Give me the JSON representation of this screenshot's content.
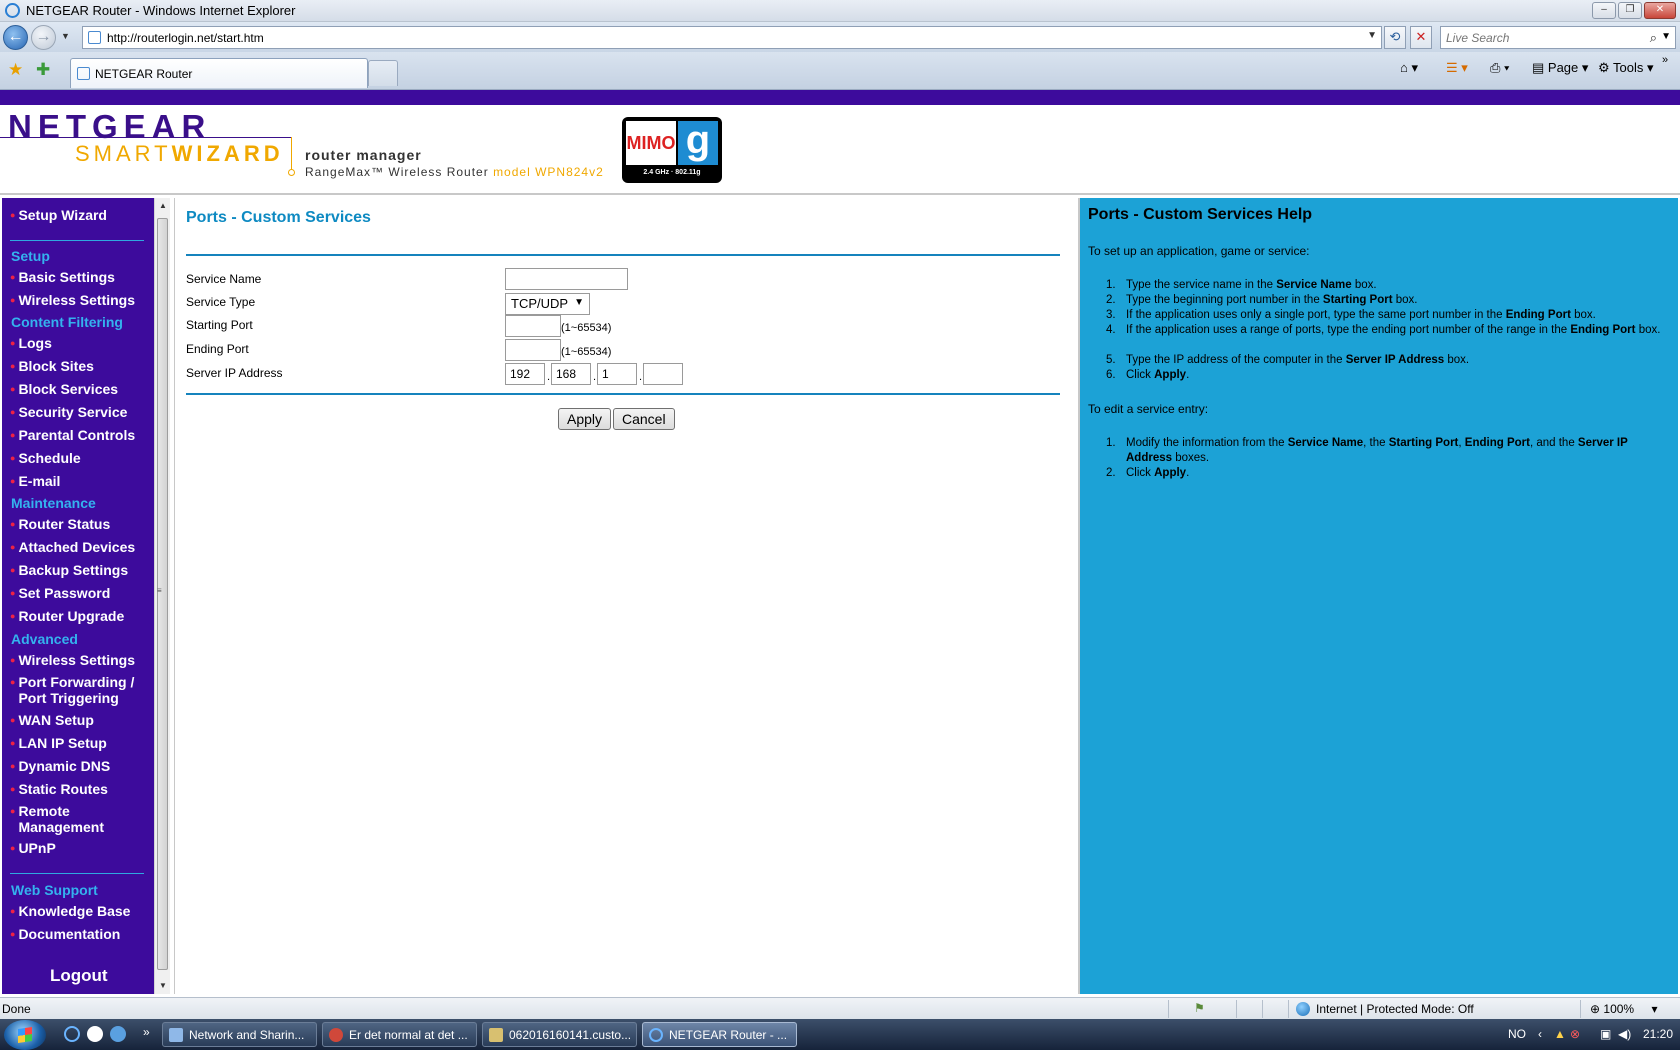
{
  "browser": {
    "window_title": "NETGEAR Router - Windows Internet Explorer",
    "url": "http://routerlogin.net/start.htm",
    "search_placeholder": "Live Search",
    "tab_label": "NETGEAR Router",
    "toolbar": {
      "page_label": "Page",
      "tools_label": "Tools"
    }
  },
  "header": {
    "brand": "NETGEAR",
    "smart": "SMART",
    "wizard": "WIZARD",
    "router_manager": "router manager",
    "product": "RangeMax™ Wireless Router ",
    "model": "model WPN824v2",
    "badge_left": "MIMO",
    "badge_right": "g",
    "badge_bottom": "2.4 GHz · 802.11g"
  },
  "sidebar": {
    "setup_wizard": "Setup Wizard",
    "cat_setup": "Setup",
    "basic_settings": "Basic Settings",
    "wireless_settings": "Wireless Settings",
    "cat_content": "Content Filtering",
    "logs": "Logs",
    "block_sites": "Block Sites",
    "block_services": "Block Services",
    "security_service": "Security Service",
    "parental_controls": "Parental Controls",
    "schedule": "Schedule",
    "email": "E-mail",
    "cat_maintenance": "Maintenance",
    "router_status": "Router Status",
    "attached_devices": "Attached Devices",
    "backup_settings": "Backup Settings",
    "set_password": "Set Password",
    "router_upgrade": "Router Upgrade",
    "cat_advanced": "Advanced",
    "adv_wireless_settings": "Wireless Settings",
    "port_forwarding": "Port Forwarding / Port Triggering",
    "wan_setup": "WAN Setup",
    "lan_ip_setup": "LAN IP Setup",
    "dynamic_dns": "Dynamic DNS",
    "static_routes": "Static Routes",
    "remote_management": "Remote Management",
    "upnp": "UPnP",
    "cat_web_support": "Web Support",
    "knowledge_base": "Knowledge Base",
    "documentation": "Documentation",
    "logout": "Logout"
  },
  "form": {
    "title": "Ports - Custom Services",
    "service_name_label": "Service Name",
    "service_name_value": "",
    "service_type_label": "Service Type",
    "service_type_value": "TCP/UDP",
    "starting_port_label": "Starting Port",
    "starting_port_value": "",
    "ending_port_label": "Ending Port",
    "ending_port_value": "",
    "port_range": "(1~65534)",
    "server_ip_label": "Server IP Address",
    "ip_octets": [
      "192",
      "168",
      "1",
      ""
    ],
    "apply_label": "Apply",
    "cancel_label": "Cancel"
  },
  "help": {
    "title": "Ports - Custom Services Help",
    "intro1": "To set up an application, game or service:",
    "steps1": [
      "Type the service name in the Service Name box.",
      "Type the beginning port number in the Starting Port box.",
      "If the application uses only a single port, type the same port number in the Ending Port box.",
      "If the application uses a range of ports, type the ending port number of the range in the Ending Port box.",
      "Type the IP address of the computer in the Server IP Address box.",
      "Click Apply."
    ],
    "intro2": "To edit a service entry:",
    "steps2": [
      "Modify the information from the Service Name, the Starting Port, Ending Port, and the Server IP Address boxes.",
      "Click Apply."
    ]
  },
  "statusbar": {
    "status_text": "Done",
    "zone_text": "Internet | Protected Mode: Off",
    "zoom_text": "100%"
  },
  "taskbar": {
    "tasks": [
      "Network and Sharin...",
      "Er det normal at det ...",
      "062016160141.custo...",
      "NETGEAR Router - ..."
    ],
    "lang": "NO",
    "clock": "21:20"
  }
}
